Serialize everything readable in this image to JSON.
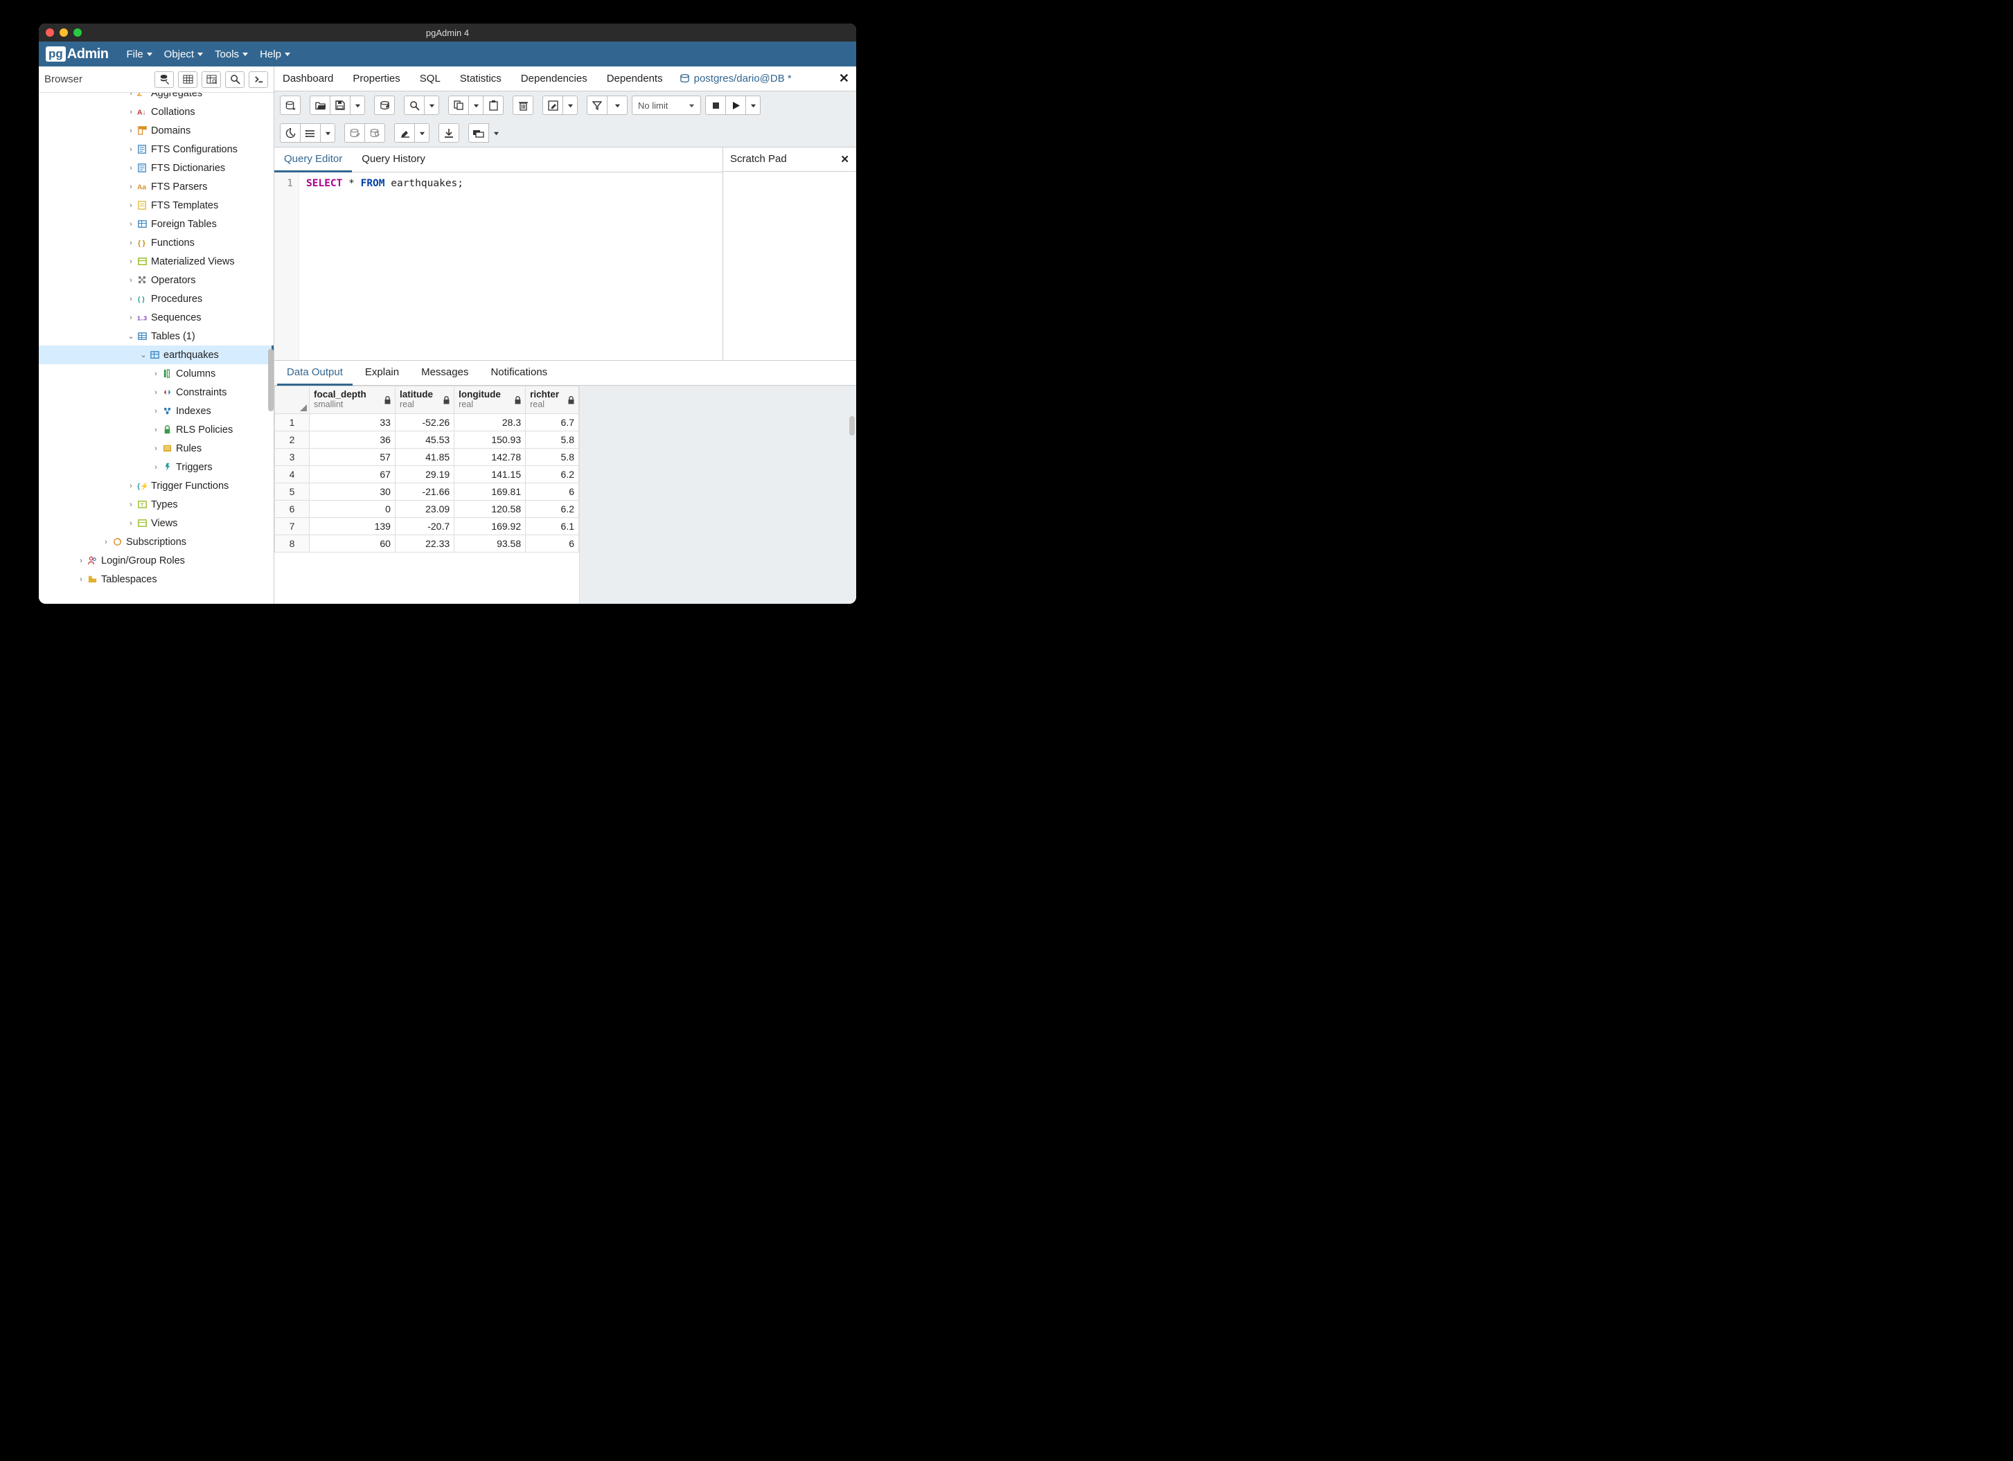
{
  "window": {
    "title": "pgAdmin 4"
  },
  "traffic": {
    "close": "#ff5f57",
    "min": "#febc2e",
    "max": "#28c840"
  },
  "logo": {
    "pg": "pg",
    "admin": "Admin"
  },
  "menubar": [
    "File",
    "Object",
    "Tools",
    "Help"
  ],
  "browser": {
    "title": "Browser",
    "tree": [
      {
        "depth": 7,
        "caret": "›",
        "icon": "agg",
        "label": "Aggregates",
        "cut": true
      },
      {
        "depth": 7,
        "caret": "›",
        "icon": "coll",
        "label": "Collations"
      },
      {
        "depth": 7,
        "caret": "›",
        "icon": "dom",
        "label": "Domains"
      },
      {
        "depth": 7,
        "caret": "›",
        "icon": "fts",
        "label": "FTS Configurations"
      },
      {
        "depth": 7,
        "caret": "›",
        "icon": "fts",
        "label": "FTS Dictionaries"
      },
      {
        "depth": 7,
        "caret": "›",
        "icon": "aa",
        "label": "FTS Parsers"
      },
      {
        "depth": 7,
        "caret": "›",
        "icon": "ftst",
        "label": "FTS Templates"
      },
      {
        "depth": 7,
        "caret": "›",
        "icon": "ftab",
        "label": "Foreign Tables"
      },
      {
        "depth": 7,
        "caret": "›",
        "icon": "func",
        "label": "Functions"
      },
      {
        "depth": 7,
        "caret": "›",
        "icon": "mview",
        "label": "Materialized Views"
      },
      {
        "depth": 7,
        "caret": "›",
        "icon": "op",
        "label": "Operators"
      },
      {
        "depth": 7,
        "caret": "›",
        "icon": "proc",
        "label": "Procedures"
      },
      {
        "depth": 7,
        "caret": "›",
        "icon": "seq",
        "label": "Sequences"
      },
      {
        "depth": 7,
        "caret": "⌄",
        "icon": "tables",
        "label": "Tables (1)"
      },
      {
        "depth": 8,
        "caret": "⌄",
        "icon": "table",
        "label": "earthquakes",
        "selected": true
      },
      {
        "depth": 9,
        "caret": "›",
        "icon": "cols",
        "label": "Columns"
      },
      {
        "depth": 9,
        "caret": "›",
        "icon": "cons",
        "label": "Constraints"
      },
      {
        "depth": 9,
        "caret": "›",
        "icon": "idx",
        "label": "Indexes"
      },
      {
        "depth": 9,
        "caret": "›",
        "icon": "rls",
        "label": "RLS Policies"
      },
      {
        "depth": 9,
        "caret": "›",
        "icon": "rules",
        "label": "Rules"
      },
      {
        "depth": 9,
        "caret": "›",
        "icon": "trig",
        "label": "Triggers"
      },
      {
        "depth": 7,
        "caret": "›",
        "icon": "tfunc",
        "label": "Trigger Functions"
      },
      {
        "depth": 7,
        "caret": "›",
        "icon": "types",
        "label": "Types"
      },
      {
        "depth": 7,
        "caret": "›",
        "icon": "views",
        "label": "Views"
      },
      {
        "depth": 5,
        "caret": "›",
        "icon": "sub",
        "label": "Subscriptions"
      },
      {
        "depth": 3,
        "caret": "›",
        "icon": "roles",
        "label": "Login/Group Roles"
      },
      {
        "depth": 3,
        "caret": "›",
        "icon": "tspace",
        "label": "Tablespaces"
      }
    ]
  },
  "main_tabs": {
    "items": [
      "Dashboard",
      "Properties",
      "SQL",
      "Statistics",
      "Dependencies",
      "Dependents"
    ],
    "active": "postgres/dario@DB *"
  },
  "toolbar": {
    "nolimit": "No limit"
  },
  "editor": {
    "tabs": [
      "Query Editor",
      "Query History"
    ],
    "line_no": "1",
    "sql": {
      "kw1": "SELECT",
      "star": " * ",
      "kw2": "FROM",
      "rest": " earthquakes;"
    },
    "scratch": "Scratch Pad"
  },
  "output_tabs": [
    "Data Output",
    "Explain",
    "Messages",
    "Notifications"
  ],
  "grid": {
    "columns": [
      {
        "name": "focal_depth",
        "type": "smallint"
      },
      {
        "name": "latitude",
        "type": "real"
      },
      {
        "name": "longitude",
        "type": "real"
      },
      {
        "name": "richter",
        "type": "real"
      }
    ],
    "rows": [
      {
        "n": "1",
        "v": [
          "33",
          "-52.26",
          "28.3",
          "6.7"
        ]
      },
      {
        "n": "2",
        "v": [
          "36",
          "45.53",
          "150.93",
          "5.8"
        ]
      },
      {
        "n": "3",
        "v": [
          "57",
          "41.85",
          "142.78",
          "5.8"
        ]
      },
      {
        "n": "4",
        "v": [
          "67",
          "29.19",
          "141.15",
          "6.2"
        ]
      },
      {
        "n": "5",
        "v": [
          "30",
          "-21.66",
          "169.81",
          "6"
        ]
      },
      {
        "n": "6",
        "v": [
          "0",
          "23.09",
          "120.58",
          "6.2"
        ]
      },
      {
        "n": "7",
        "v": [
          "139",
          "-20.7",
          "169.92",
          "6.1"
        ]
      },
      {
        "n": "8",
        "v": [
          "60",
          "22.33",
          "93.58",
          "6"
        ]
      }
    ]
  }
}
